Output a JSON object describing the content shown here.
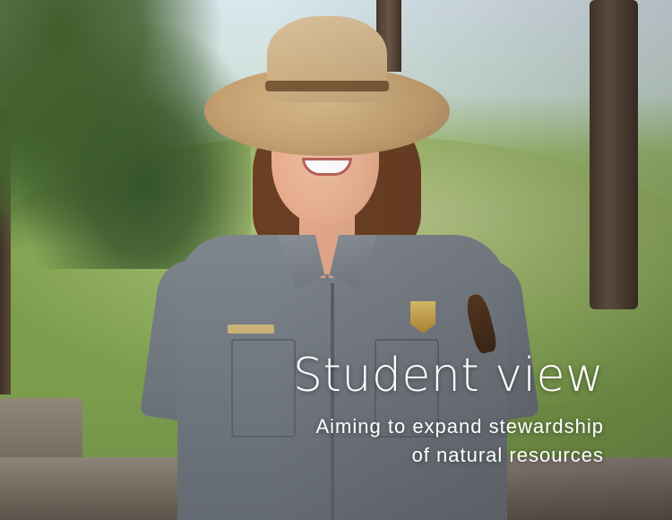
{
  "hero": {
    "title": "Student view",
    "subtitle_lines": [
      "Aiming to expand stewardship",
      "of natural resources"
    ],
    "text_color": "#ffffff"
  },
  "photo": {
    "subject": "smiling park ranger in flat hat and gray uniform shirt",
    "colors": {
      "uniform": "#737981",
      "hat": "#c9a97d",
      "grass": "#8fb05f"
    }
  }
}
